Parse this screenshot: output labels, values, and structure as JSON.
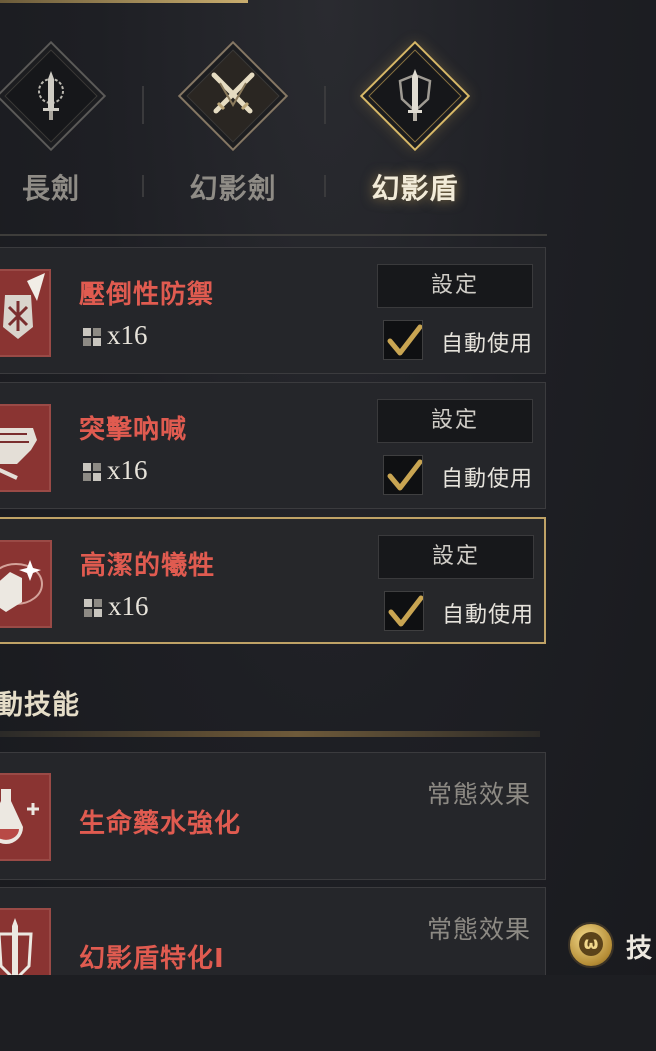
{
  "weapon_tabs": [
    {
      "label": "長劍",
      "icon": "longsword-icon",
      "active": false
    },
    {
      "label": "幻影劍",
      "icon": "crossed-swords-icon",
      "active": false
    },
    {
      "label": "幻影盾",
      "icon": "shield-sword-icon",
      "active": true
    }
  ],
  "active_skills": [
    {
      "name": "壓倒性防禦",
      "cost": "x16",
      "set_label": "設定",
      "auto_label": "自動使用",
      "auto_checked": true,
      "selected": false
    },
    {
      "name": "突擊吶喊",
      "cost": "x16",
      "set_label": "設定",
      "auto_label": "自動使用",
      "auto_checked": true,
      "selected": false
    },
    {
      "name": "高潔的犧牲",
      "cost": "x16",
      "set_label": "設定",
      "auto_label": "自動使用",
      "auto_checked": true,
      "selected": true
    }
  ],
  "passive_section": {
    "title": "動技能"
  },
  "passive_skills": [
    {
      "name": "生命藥水強化",
      "tag": "常態效果"
    },
    {
      "name": "幻影盾特化I",
      "tag": "常態效果"
    }
  ],
  "skill_coin_button": {
    "label": "技",
    "glyph": "ω"
  },
  "colors": {
    "accent_gold": "#d8b968",
    "skill_name_red": "#e05b50",
    "icon_bg": "#7a2e2e"
  }
}
